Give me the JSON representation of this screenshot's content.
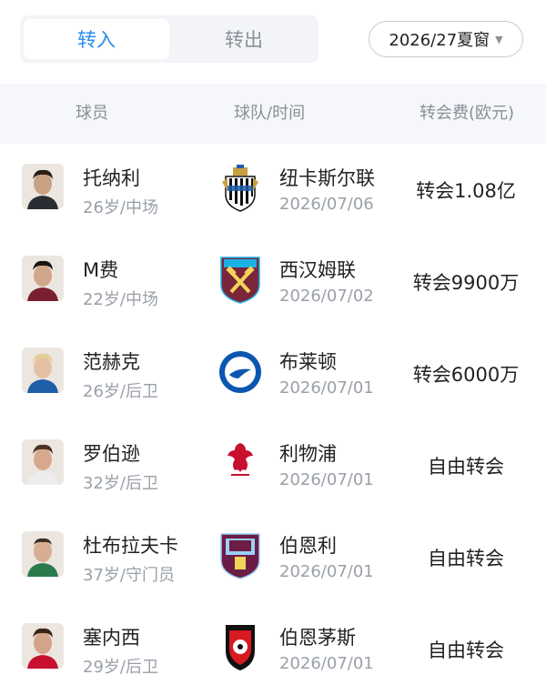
{
  "tabs": [
    {
      "label": "转入",
      "active": true
    },
    {
      "label": "转出",
      "active": false
    }
  ],
  "season": {
    "label": "2026/27夏窗",
    "icon": "caret-down-icon"
  },
  "columns": {
    "player": "球员",
    "team_time": "球队/时间",
    "fee": "转会费(欧元)"
  },
  "colors": {
    "accent": "#2b8df0",
    "muted": "#9aa0a8",
    "header_bg": "#f5f7fa"
  },
  "rows": [
    {
      "name": "托纳利",
      "meta": "26岁/中场",
      "team": "纽卡斯尔联",
      "date": "2026/07/06",
      "fee": "转会1.08亿",
      "crest": "newcastle-crest-icon"
    },
    {
      "name": "M费",
      "meta": "22岁/中场",
      "team": "西汉姆联",
      "date": "2026/07/02",
      "fee": "转会9900万",
      "crest": "west-ham-crest-icon"
    },
    {
      "name": "范赫克",
      "meta": "26岁/后卫",
      "team": "布莱顿",
      "date": "2026/07/01",
      "fee": "转会6000万",
      "crest": "brighton-crest-icon"
    },
    {
      "name": "罗伯逊",
      "meta": "32岁/后卫",
      "team": "利物浦",
      "date": "2026/07/01",
      "fee": "自由转会",
      "crest": "liverpool-crest-icon"
    },
    {
      "name": "杜布拉夫卡",
      "meta": "37岁/守门员",
      "team": "伯恩利",
      "date": "2026/07/01",
      "fee": "自由转会",
      "crest": "burnley-crest-icon"
    },
    {
      "name": "塞内西",
      "meta": "29岁/后卫",
      "team": "伯恩茅斯",
      "date": "2026/07/01",
      "fee": "自由转会",
      "crest": "bournemouth-crest-icon"
    }
  ]
}
